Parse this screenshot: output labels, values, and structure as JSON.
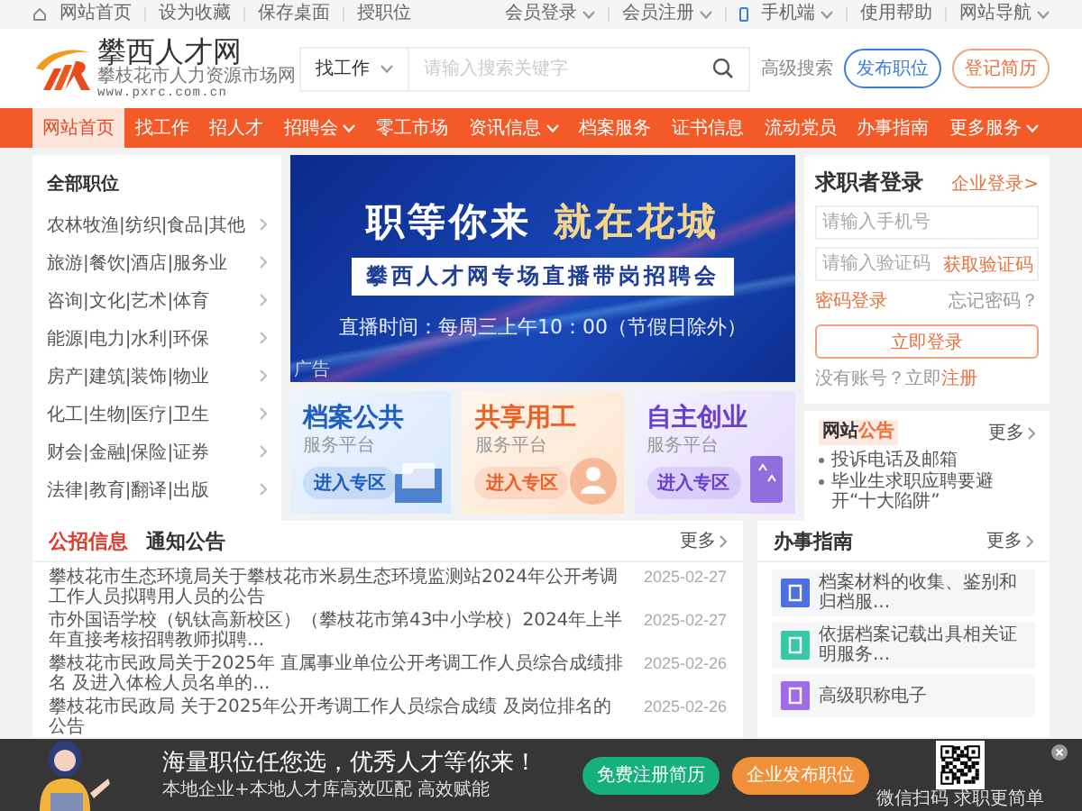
{
  "top_bar": {
    "left_links": [
      "网站首页",
      "设为收藏",
      "保存桌面",
      "授职位"
    ],
    "right_links": [
      {
        "label": "会员登录",
        "dropdown": true
      },
      {
        "label": "会员注册",
        "dropdown": true
      },
      {
        "label": "手机端",
        "dropdown": true
      },
      {
        "label": "使用帮助",
        "dropdown": false
      },
      {
        "label": "网站导航",
        "dropdown": true
      }
    ]
  },
  "header": {
    "site_name": "攀西人才网",
    "tagline": "攀枝花市人力资源市场网",
    "url": "www.pxrc.com.cn",
    "search": {
      "category": "找工作",
      "placeholder": "请输入搜索关键字"
    },
    "advanced_search": "高级搜索",
    "buttons": [
      {
        "label": "发布职位",
        "kind": "primary"
      },
      {
        "label": "登记简历",
        "kind": "secondary"
      }
    ]
  },
  "nav": [
    {
      "label": "网站首页",
      "selected": true,
      "dropdown": false
    },
    {
      "label": "找工作",
      "selected": false,
      "dropdown": false
    },
    {
      "label": "招人才",
      "selected": false,
      "dropdown": false
    },
    {
      "label": "招聘会",
      "selected": false,
      "dropdown": true
    },
    {
      "label": "零工市场",
      "selected": false,
      "dropdown": false
    },
    {
      "label": "资讯信息",
      "selected": false,
      "dropdown": true
    },
    {
      "label": "档案服务",
      "selected": false,
      "dropdown": false
    },
    {
      "label": "证书信息",
      "selected": false,
      "dropdown": false
    },
    {
      "label": "流动党员",
      "selected": false,
      "dropdown": false
    },
    {
      "label": "办事指南",
      "selected": false,
      "dropdown": false
    },
    {
      "label": "更多服务",
      "selected": false,
      "dropdown": true
    }
  ],
  "categories": {
    "title": "全部职位",
    "items": [
      "农林牧渔|纺织|食品|其他",
      "旅游|餐饮|酒店|服务业",
      "咨询|文化|艺术|体育",
      "能源|电力|水利|环保",
      "房产|建筑|装饰|物业",
      "化工|生物|医疗|卫生",
      "财会|金融|保险|证券",
      "法律|教育|翻译|出版"
    ]
  },
  "banner": {
    "headline_left": "职等你来",
    "headline_right": "就在花城",
    "subtitle": "攀西人才网专场直播带岗招聘会",
    "schedule": "直播时间：每周三上午10：00（节假日除外）",
    "ad_label": "广告"
  },
  "service_cards": [
    {
      "title": "档案公共",
      "subtitle": "服务平台",
      "action": "进入专区",
      "kind": "archive",
      "color": "#1f5fbf"
    },
    {
      "title": "共享用工",
      "subtitle": "服务平台",
      "action": "进入专区",
      "kind": "staffing",
      "color": "#e8632a"
    },
    {
      "title": "自主创业",
      "subtitle": "服务平台",
      "action": "进入专区",
      "kind": "startup",
      "color": "#6a3fd0"
    }
  ],
  "login": {
    "title": "求职者登录",
    "switch_link": "企业登录>",
    "phone_placeholder": "请输入手机号",
    "code_placeholder": "请输入验证码",
    "get_code": "获取验证码",
    "password_login": "密码登录",
    "forgot": "忘记密码？",
    "submit": "立即登录",
    "register_prompt": "没有账号？立即",
    "register_link": "注册"
  },
  "announcements": {
    "title_left": "网站",
    "title_right": "公告",
    "more": "更多",
    "items": [
      "投诉电话及邮箱",
      "毕业生求职应聘要避开“十大陷阱”"
    ]
  },
  "news": {
    "tabs": [
      {
        "label": "公招信息",
        "selected": true
      },
      {
        "label": "通知公告",
        "selected": false
      }
    ],
    "more": "更多",
    "rows": [
      {
        "title": "攀枝花市生态环境局关于攀枝花市米易生态环境监测站2024年公开考调工作人员拟聘用人员的公告",
        "date": "2025-02-27"
      },
      {
        "title": "市外国语学校（钒钛高新校区）（攀枝花市第43中小学校）2024年上半年直接考核招聘教师拟聘...",
        "date": "2025-02-27"
      },
      {
        "title": "攀枝花市民政局关于2025年 直属事业单位公开考调工作人员综合成绩排名 及进入体检人员名单的...",
        "date": "2025-02-26"
      },
      {
        "title": "攀枝花市民政局 关于2025年公开考调工作人员综合成绩 及岗位排名的公告",
        "date": "2025-02-26"
      }
    ]
  },
  "guide": {
    "title": "办事指南",
    "more": "更多",
    "items": [
      {
        "title": "档案材料的收集、鉴别和归档服...",
        "color": "#4f6fe6"
      },
      {
        "title": "依据档案记载出具相关证明服务...",
        "color": "#35c9a8"
      },
      {
        "title": "高级职称电子",
        "color": "#a06be8"
      }
    ]
  },
  "promo": {
    "headline": "海量职位任您选，优秀人才等你来！",
    "subline": "本地企业+本地人才库高效匹配 高效赋能",
    "buttons": [
      {
        "label": "免费注册简历",
        "kind": "register"
      },
      {
        "label": "企业发布职位",
        "kind": "post"
      }
    ],
    "qr_caption": "微信扫码 求职更简单"
  }
}
